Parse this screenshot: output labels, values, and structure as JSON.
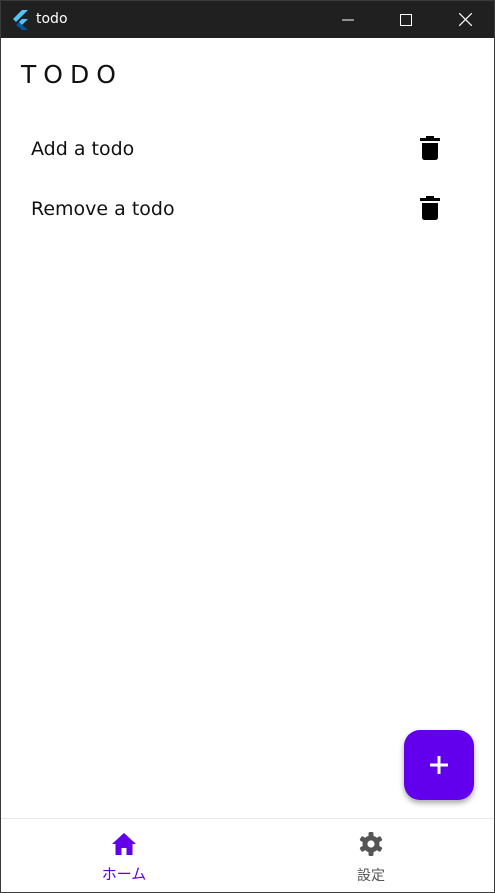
{
  "window": {
    "title": "todo"
  },
  "page": {
    "title": "TODO"
  },
  "todos": [
    {
      "label": "Add a todo"
    },
    {
      "label": "Remove a todo"
    }
  ],
  "bottom_nav": {
    "items": [
      {
        "label": "ホーム",
        "icon": "home-icon",
        "selected": true
      },
      {
        "label": "設定",
        "icon": "gear-icon",
        "selected": false
      }
    ]
  },
  "colors": {
    "accent": "#6200ee",
    "titlebar": "#202020",
    "text": "#111111",
    "inactive": "#555555"
  }
}
